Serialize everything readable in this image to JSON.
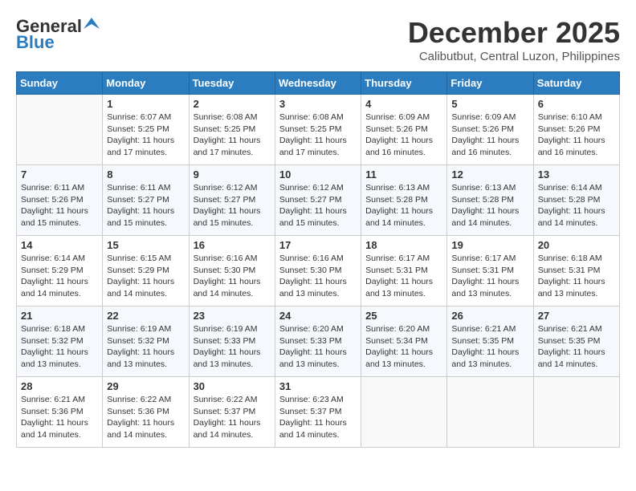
{
  "logo": {
    "general": "General",
    "blue": "Blue"
  },
  "header": {
    "month": "December 2025",
    "location": "Calibutbut, Central Luzon, Philippines"
  },
  "weekdays": [
    "Sunday",
    "Monday",
    "Tuesday",
    "Wednesday",
    "Thursday",
    "Friday",
    "Saturday"
  ],
  "weeks": [
    [
      {
        "day": "",
        "info": ""
      },
      {
        "day": "1",
        "info": "Sunrise: 6:07 AM\nSunset: 5:25 PM\nDaylight: 11 hours\nand 17 minutes."
      },
      {
        "day": "2",
        "info": "Sunrise: 6:08 AM\nSunset: 5:25 PM\nDaylight: 11 hours\nand 17 minutes."
      },
      {
        "day": "3",
        "info": "Sunrise: 6:08 AM\nSunset: 5:25 PM\nDaylight: 11 hours\nand 17 minutes."
      },
      {
        "day": "4",
        "info": "Sunrise: 6:09 AM\nSunset: 5:26 PM\nDaylight: 11 hours\nand 16 minutes."
      },
      {
        "day": "5",
        "info": "Sunrise: 6:09 AM\nSunset: 5:26 PM\nDaylight: 11 hours\nand 16 minutes."
      },
      {
        "day": "6",
        "info": "Sunrise: 6:10 AM\nSunset: 5:26 PM\nDaylight: 11 hours\nand 16 minutes."
      }
    ],
    [
      {
        "day": "7",
        "info": "Sunrise: 6:11 AM\nSunset: 5:26 PM\nDaylight: 11 hours\nand 15 minutes."
      },
      {
        "day": "8",
        "info": "Sunrise: 6:11 AM\nSunset: 5:27 PM\nDaylight: 11 hours\nand 15 minutes."
      },
      {
        "day": "9",
        "info": "Sunrise: 6:12 AM\nSunset: 5:27 PM\nDaylight: 11 hours\nand 15 minutes."
      },
      {
        "day": "10",
        "info": "Sunrise: 6:12 AM\nSunset: 5:27 PM\nDaylight: 11 hours\nand 15 minutes."
      },
      {
        "day": "11",
        "info": "Sunrise: 6:13 AM\nSunset: 5:28 PM\nDaylight: 11 hours\nand 14 minutes."
      },
      {
        "day": "12",
        "info": "Sunrise: 6:13 AM\nSunset: 5:28 PM\nDaylight: 11 hours\nand 14 minutes."
      },
      {
        "day": "13",
        "info": "Sunrise: 6:14 AM\nSunset: 5:28 PM\nDaylight: 11 hours\nand 14 minutes."
      }
    ],
    [
      {
        "day": "14",
        "info": "Sunrise: 6:14 AM\nSunset: 5:29 PM\nDaylight: 11 hours\nand 14 minutes."
      },
      {
        "day": "15",
        "info": "Sunrise: 6:15 AM\nSunset: 5:29 PM\nDaylight: 11 hours\nand 14 minutes."
      },
      {
        "day": "16",
        "info": "Sunrise: 6:16 AM\nSunset: 5:30 PM\nDaylight: 11 hours\nand 14 minutes."
      },
      {
        "day": "17",
        "info": "Sunrise: 6:16 AM\nSunset: 5:30 PM\nDaylight: 11 hours\nand 13 minutes."
      },
      {
        "day": "18",
        "info": "Sunrise: 6:17 AM\nSunset: 5:31 PM\nDaylight: 11 hours\nand 13 minutes."
      },
      {
        "day": "19",
        "info": "Sunrise: 6:17 AM\nSunset: 5:31 PM\nDaylight: 11 hours\nand 13 minutes."
      },
      {
        "day": "20",
        "info": "Sunrise: 6:18 AM\nSunset: 5:31 PM\nDaylight: 11 hours\nand 13 minutes."
      }
    ],
    [
      {
        "day": "21",
        "info": "Sunrise: 6:18 AM\nSunset: 5:32 PM\nDaylight: 11 hours\nand 13 minutes."
      },
      {
        "day": "22",
        "info": "Sunrise: 6:19 AM\nSunset: 5:32 PM\nDaylight: 11 hours\nand 13 minutes."
      },
      {
        "day": "23",
        "info": "Sunrise: 6:19 AM\nSunset: 5:33 PM\nDaylight: 11 hours\nand 13 minutes."
      },
      {
        "day": "24",
        "info": "Sunrise: 6:20 AM\nSunset: 5:33 PM\nDaylight: 11 hours\nand 13 minutes."
      },
      {
        "day": "25",
        "info": "Sunrise: 6:20 AM\nSunset: 5:34 PM\nDaylight: 11 hours\nand 13 minutes."
      },
      {
        "day": "26",
        "info": "Sunrise: 6:21 AM\nSunset: 5:35 PM\nDaylight: 11 hours\nand 13 minutes."
      },
      {
        "day": "27",
        "info": "Sunrise: 6:21 AM\nSunset: 5:35 PM\nDaylight: 11 hours\nand 14 minutes."
      }
    ],
    [
      {
        "day": "28",
        "info": "Sunrise: 6:21 AM\nSunset: 5:36 PM\nDaylight: 11 hours\nand 14 minutes."
      },
      {
        "day": "29",
        "info": "Sunrise: 6:22 AM\nSunset: 5:36 PM\nDaylight: 11 hours\nand 14 minutes."
      },
      {
        "day": "30",
        "info": "Sunrise: 6:22 AM\nSunset: 5:37 PM\nDaylight: 11 hours\nand 14 minutes."
      },
      {
        "day": "31",
        "info": "Sunrise: 6:23 AM\nSunset: 5:37 PM\nDaylight: 11 hours\nand 14 minutes."
      },
      {
        "day": "",
        "info": ""
      },
      {
        "day": "",
        "info": ""
      },
      {
        "day": "",
        "info": ""
      }
    ]
  ]
}
